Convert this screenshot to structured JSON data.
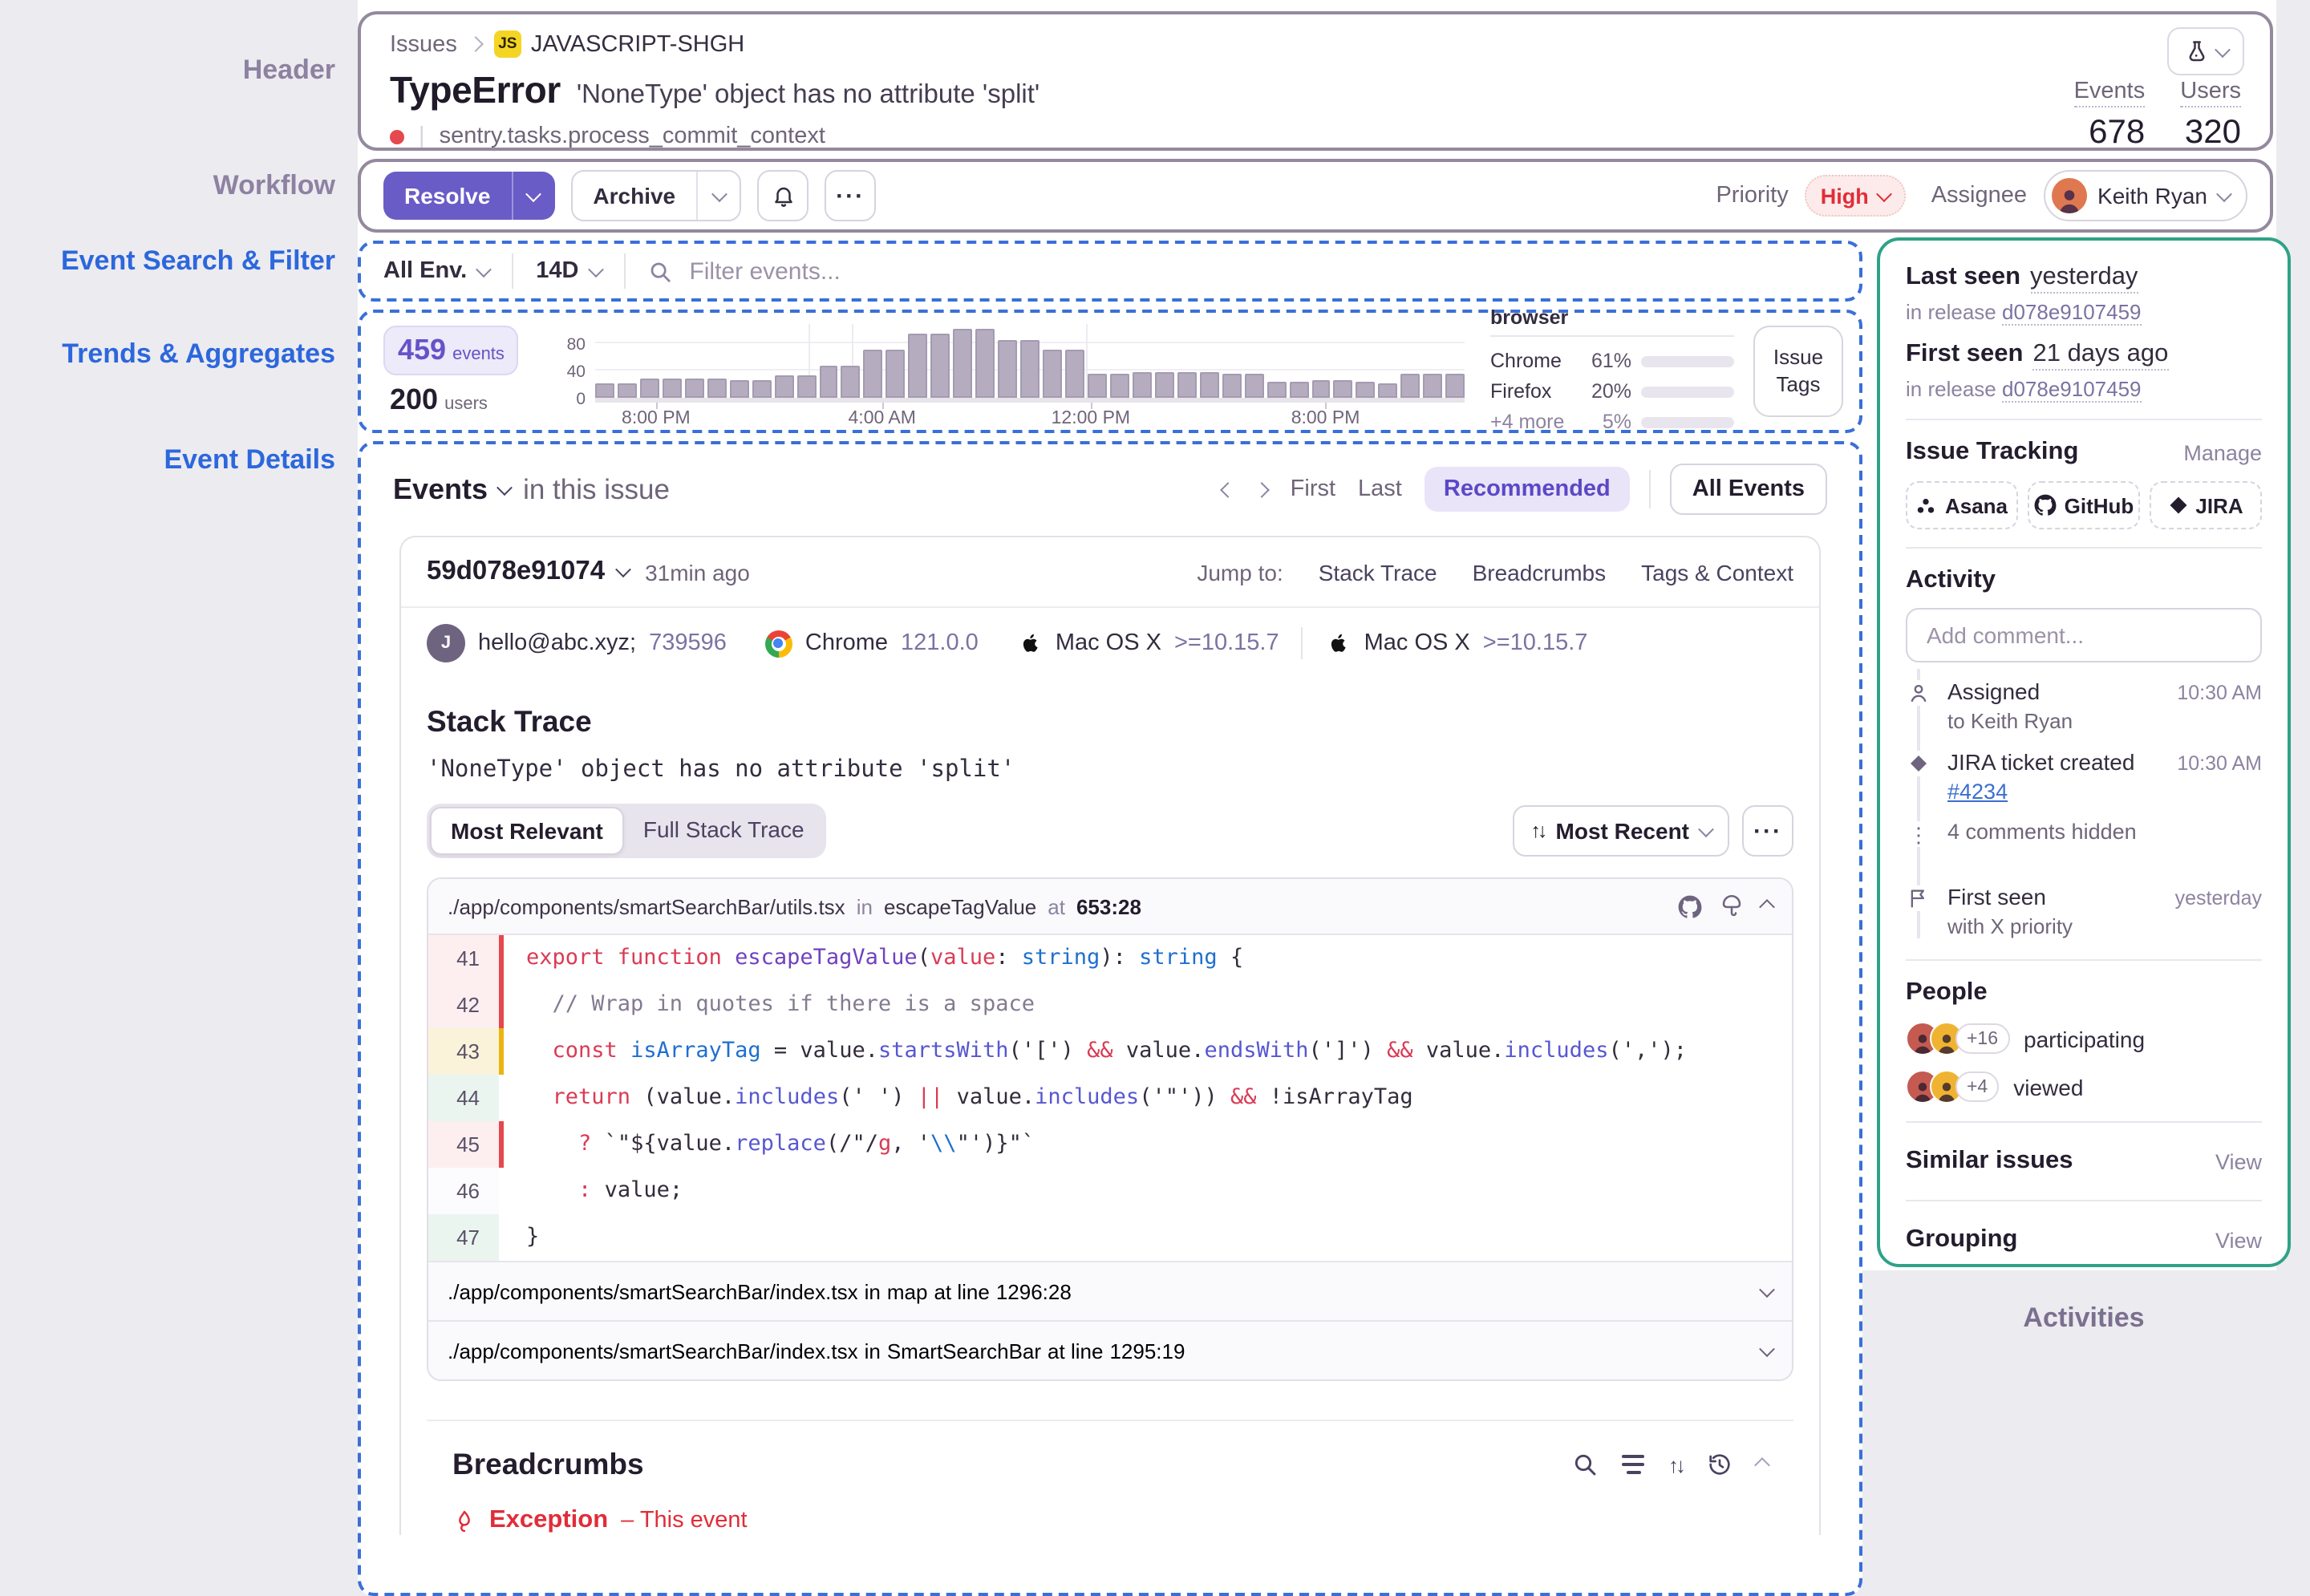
{
  "colors": {
    "accent": "#6a5cc6",
    "blue-ann": "#2c67dd",
    "muted-ann": "#8d82a2",
    "teal-border": "#2fa287",
    "dashed-blue": "#3a6fd8",
    "solid-border": "#94899e",
    "red": "#e12d39",
    "red-bar": "#e5484d",
    "yellow-bar": "#ecb40e",
    "chip-purple-bg": "#edeaf9",
    "chip-purple-text": "#6553c8",
    "rec-bg": "#e9e4f8",
    "rec-text": "#5b48c6",
    "bar-fill": "#b5acc0",
    "legend-fill": "#7b6f92",
    "text-muted": "#6f6579",
    "link-blue": "#3b6ed0",
    "js-badge": "#f5d524",
    "high-bg": "#fcebea",
    "high-border": "#eec7c4",
    "avatar-orange": "#e0784f",
    "avatar-red": "#c45a50",
    "avatar-yellow": "#f0b331",
    "code-plain": "#332c3b",
    "code-kw": "#da3b54",
    "code-fn": "#6f42c1",
    "code-meth": "#5757d1",
    "code-type": "#1f6fce",
    "code-comment": "#847b90"
  },
  "annotations": {
    "header": "Header",
    "workflow": "Workflow",
    "search": "Event Search & Filter",
    "trends": "Trends & Aggregates",
    "details": "Event Details",
    "activities": "Activities"
  },
  "icons": {
    "overflow": "···",
    "dots_vertical": "⋮",
    "sort_arrows": "↑↓"
  },
  "breadcrumb": {
    "issues": "Issues",
    "js_badge": "JS",
    "project": "JAVASCRIPT-SHGH"
  },
  "header": {
    "title": "TypeError",
    "subtitle": "'NoneType' object has no attribute 'split'",
    "culprit": "sentry.tasks.process_commit_context",
    "events_label": "Events",
    "events_value": "678",
    "users_label": "Users",
    "users_value": "320"
  },
  "workflow": {
    "resolve": "Resolve",
    "archive": "Archive",
    "priority_label": "Priority",
    "priority_value": "High",
    "assignee_label": "Assignee",
    "assignee_name": "Keith Ryan"
  },
  "filters": {
    "env": "All Env.",
    "range": "14D",
    "search_placeholder": "Filter events..."
  },
  "trends": {
    "events_count": "459",
    "events_unit": "events",
    "users_count": "200",
    "users_unit": "users",
    "tags_button": "Issue Tags",
    "browser": {
      "title": "browser",
      "rows": [
        {
          "name": "Chrome",
          "pct": "61%",
          "fill": 61,
          "muted": false
        },
        {
          "name": "Firefox",
          "pct": "20%",
          "fill": 20,
          "muted": false
        },
        {
          "name": "+4 more",
          "pct": "5%",
          "fill": 5,
          "muted": true
        }
      ]
    }
  },
  "chart_data": {
    "type": "bar",
    "title": "events histogram (14d)",
    "values": [
      20,
      20,
      28,
      28,
      28,
      28,
      24,
      24,
      32,
      32,
      46,
      46,
      70,
      70,
      94,
      94,
      102,
      102,
      84,
      84,
      70,
      70,
      35,
      35,
      38,
      38,
      36,
      36,
      35,
      35,
      22,
      22,
      26,
      26,
      22,
      20,
      34,
      34,
      34
    ],
    "ylim": [
      0,
      105
    ],
    "y_ticks": [
      {
        "label": "80",
        "value": 80
      },
      {
        "label": "40",
        "value": 40
      },
      {
        "label": "0",
        "value": 0
      }
    ],
    "x_ticks": [
      {
        "label": "8:00 PM",
        "pos_pct": 7
      },
      {
        "label": "4:00 AM",
        "pos_pct": 33
      },
      {
        "label": "12:00 PM",
        "pos_pct": 57
      },
      {
        "label": "8:00 PM",
        "pos_pct": 84
      }
    ],
    "vgrid_pct": [
      24.5,
      29.5,
      56.5
    ],
    "grid": "horizontal",
    "legend_position": "right",
    "xlabel": "",
    "ylabel": ""
  },
  "events_section": {
    "title": "Events",
    "subtitle": "in this issue",
    "first": "First",
    "last": "Last",
    "recommended": "Recommended",
    "all_events": "All Events"
  },
  "event": {
    "id": "59d078e91074",
    "age": "31min ago",
    "jump_label": "Jump to:",
    "jump_links": [
      "Stack Trace",
      "Breadcrumbs",
      "Tags & Context"
    ],
    "user_initial": "J",
    "email": "hello@abc.xyz;",
    "user_id": "739596",
    "browser": "Chrome",
    "browser_version": "121.0.0",
    "os": "Mac OS X",
    "os_version": ">=10.15.7",
    "os2": "Mac OS X",
    "os2_version": ">=10.15.7"
  },
  "stack": {
    "title": "Stack Trace",
    "message": "'NoneType' object has no attribute 'split'",
    "tab_active": "Most Relevant",
    "tab_inactive": "Full Stack Trace",
    "sort_label": "Most Recent",
    "frame_header": {
      "path": "./app/components/smartSearchBar/utils.tsx",
      "in_word": "in",
      "func": "escapeTagValue",
      "at_word": "at",
      "loc": "653:28"
    },
    "code_lines": [
      {
        "n": "41",
        "g": "pink",
        "b": "red",
        "tokens": [
          [
            "k",
            "export function "
          ],
          [
            "f",
            "escapeTagValue"
          ],
          [
            "p",
            "("
          ],
          [
            "k",
            "value"
          ],
          [
            "p",
            ": "
          ],
          [
            "t",
            "string"
          ],
          [
            "p",
            "): "
          ],
          [
            "t",
            "string"
          ],
          [
            "p",
            " {"
          ]
        ]
      },
      {
        "n": "42",
        "g": "pink",
        "b": "red",
        "tokens": [
          [
            "c",
            "  // Wrap in quotes if there is a space"
          ]
        ]
      },
      {
        "n": "43",
        "g": "yellow",
        "b": "yellow",
        "tokens": [
          [
            "p",
            "  "
          ],
          [
            "k",
            "const"
          ],
          [
            "p",
            " "
          ],
          [
            "t",
            "isArrayTag"
          ],
          [
            "p",
            " = value."
          ],
          [
            "m",
            "startsWith"
          ],
          [
            "p",
            "('[') "
          ],
          [
            "k",
            "&&"
          ],
          [
            "p",
            " value."
          ],
          [
            "m",
            "endsWith"
          ],
          [
            "p",
            "(']') "
          ],
          [
            "k",
            "&&"
          ],
          [
            "p",
            " value."
          ],
          [
            "m",
            "includes"
          ],
          [
            "p",
            "(',');"
          ]
        ]
      },
      {
        "n": "44",
        "g": "green",
        "b": "none",
        "tokens": [
          [
            "p",
            "  "
          ],
          [
            "k",
            "return"
          ],
          [
            "p",
            " (value."
          ],
          [
            "m",
            "includes"
          ],
          [
            "p",
            "(' ') "
          ],
          [
            "k",
            "||"
          ],
          [
            "p",
            " value."
          ],
          [
            "m",
            "includes"
          ],
          [
            "p",
            "('\"')) "
          ],
          [
            "k",
            "&&"
          ],
          [
            "p",
            " !isArrayTag"
          ]
        ]
      },
      {
        "n": "45",
        "g": "pink",
        "b": "red",
        "tokens": [
          [
            "p",
            "    "
          ],
          [
            "k",
            "?"
          ],
          [
            "p",
            " `\"${value."
          ],
          [
            "m",
            "replace"
          ],
          [
            "p",
            "(/\"/"
          ],
          [
            "r",
            "g"
          ],
          [
            "p",
            ", '"
          ],
          [
            "u",
            "\\\\"
          ],
          [
            "p",
            "\"')}\"`"
          ]
        ]
      },
      {
        "n": "46",
        "g": "none",
        "b": "none",
        "tokens": [
          [
            "p",
            "    "
          ],
          [
            "k",
            ":"
          ],
          [
            "p",
            " value;"
          ]
        ]
      },
      {
        "n": "47",
        "g": "green",
        "b": "none",
        "tokens": [
          [
            "p",
            "}"
          ]
        ]
      }
    ],
    "collapsed_frames": [
      {
        "path": "./app/components/smartSearchBar/index.tsx",
        "in_word": "in",
        "func": "map",
        "at_word": "at line",
        "loc": "1296:28"
      },
      {
        "path": "./app/components/smartSearchBar/index.tsx",
        "in_word": "in",
        "func": "SmartSearchBar",
        "at_word": "at line",
        "loc": "1295:19"
      }
    ]
  },
  "breadcrumbs_panel": {
    "title": "Breadcrumbs",
    "exception_label": "Exception",
    "exception_detail": "– This event"
  },
  "sidebar": {
    "last_seen_label": "Last seen",
    "last_seen_value": "yesterday",
    "release_prefix": "in release",
    "last_release": "d078e9107459",
    "first_seen_label": "First seen",
    "first_seen_value": "21 days ago",
    "first_release": "d078e9107459",
    "tracking_title": "Issue Tracking",
    "manage_link": "Manage",
    "integrations": [
      {
        "name": "Asana",
        "icon": "asana"
      },
      {
        "name": "GitHub",
        "icon": "github"
      },
      {
        "name": "JIRA",
        "icon": "jira"
      }
    ],
    "activity_title": "Activity",
    "comment_placeholder": "Add comment...",
    "activity_items": [
      {
        "icon": "user",
        "title": "Assigned",
        "time": "10:30 AM",
        "sub": "to Keith Ryan"
      },
      {
        "icon": "diamond",
        "title": "JIRA ticket created",
        "time": "10:30 AM",
        "link": "#4234"
      },
      {
        "icon": "dots",
        "title": "4 comments hidden",
        "muted": true
      },
      {
        "icon": "flag",
        "title": "First seen",
        "time": "yesterday",
        "sub": "with X priority"
      }
    ],
    "people_title": "People",
    "people_rows": [
      {
        "badge": "+16",
        "label": "participating"
      },
      {
        "badge": "+4",
        "label": "viewed"
      }
    ],
    "similar_label": "Similar issues",
    "grouping_label": "Grouping",
    "view_link": "View"
  }
}
